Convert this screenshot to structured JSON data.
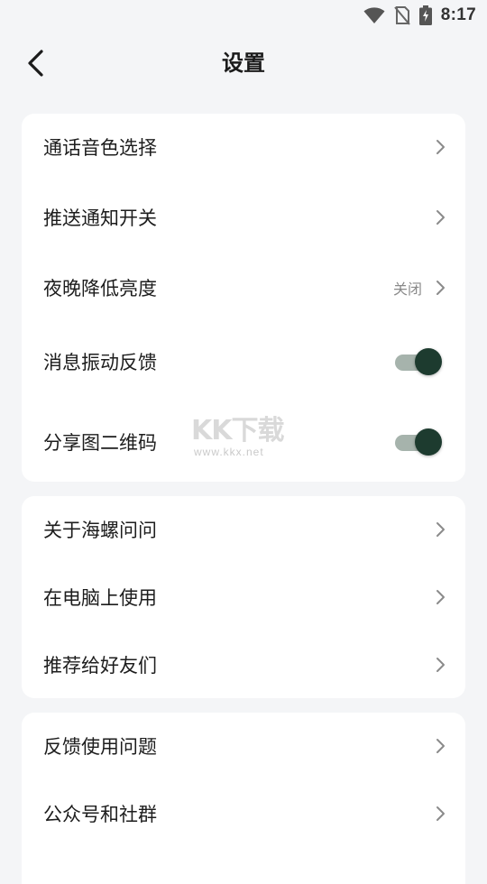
{
  "status_bar": {
    "time": "8:17",
    "icons": [
      "wifi-icon",
      "no-sim-icon",
      "battery-charging-icon"
    ]
  },
  "header": {
    "title": "设置",
    "back_icon": "back-arrow-icon"
  },
  "sections": [
    {
      "items": [
        {
          "label": "通话音色选择",
          "type": "link"
        },
        {
          "label": "推送通知开关",
          "type": "link"
        },
        {
          "label": "夜晚降低亮度",
          "type": "link",
          "value": "关闭"
        },
        {
          "label": "消息振动反馈",
          "type": "toggle",
          "on": true
        },
        {
          "label": "分享图二维码",
          "type": "toggle",
          "on": true
        }
      ]
    },
    {
      "items": [
        {
          "label": "关于海螺问问",
          "type": "link"
        },
        {
          "label": "在电脑上使用",
          "type": "link"
        },
        {
          "label": "推荐给好友们",
          "type": "link"
        }
      ]
    },
    {
      "items": [
        {
          "label": "反馈使用问题",
          "type": "link"
        },
        {
          "label": "公众号和社群",
          "type": "link"
        }
      ]
    }
  ],
  "watermark": {
    "logo_text": "KK下载",
    "url": "www.kkx.net"
  },
  "colors": {
    "background": "#f4f5f7",
    "card": "#ffffff",
    "toggle_on_knob": "#1d3b2f",
    "toggle_on_track": "#a6b3ac",
    "secondary_text": "#8a8a8a"
  }
}
